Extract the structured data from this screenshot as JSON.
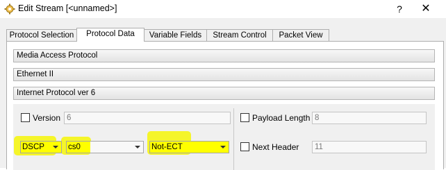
{
  "window": {
    "title": "Edit Stream [<unnamed>]",
    "help": "?",
    "close": "✕",
    "icon": "stream-gear-icon"
  },
  "tabs": [
    {
      "label": "Protocol Selection",
      "active": false
    },
    {
      "label": "Protocol Data",
      "active": true
    },
    {
      "label": "Variable Fields",
      "active": false
    },
    {
      "label": "Stream Control",
      "active": false
    },
    {
      "label": "Packet View",
      "active": false
    }
  ],
  "sections": [
    "Media Access Protocol",
    "Ethernet II",
    "Internet Protocol ver 6"
  ],
  "ipv6": {
    "version": {
      "label": "Version",
      "value": "6",
      "checked": false
    },
    "payload_length": {
      "label": "Payload Length",
      "value": "8",
      "checked": false
    },
    "next_header": {
      "label": "Next Header",
      "value": "11",
      "checked": false
    },
    "dscp_mode": "DSCP",
    "dscp_value": "cs0",
    "ecn": "Not-ECT"
  },
  "colors": {
    "highlight": "#ffff00",
    "panel_bg": "#f0f0f0"
  }
}
